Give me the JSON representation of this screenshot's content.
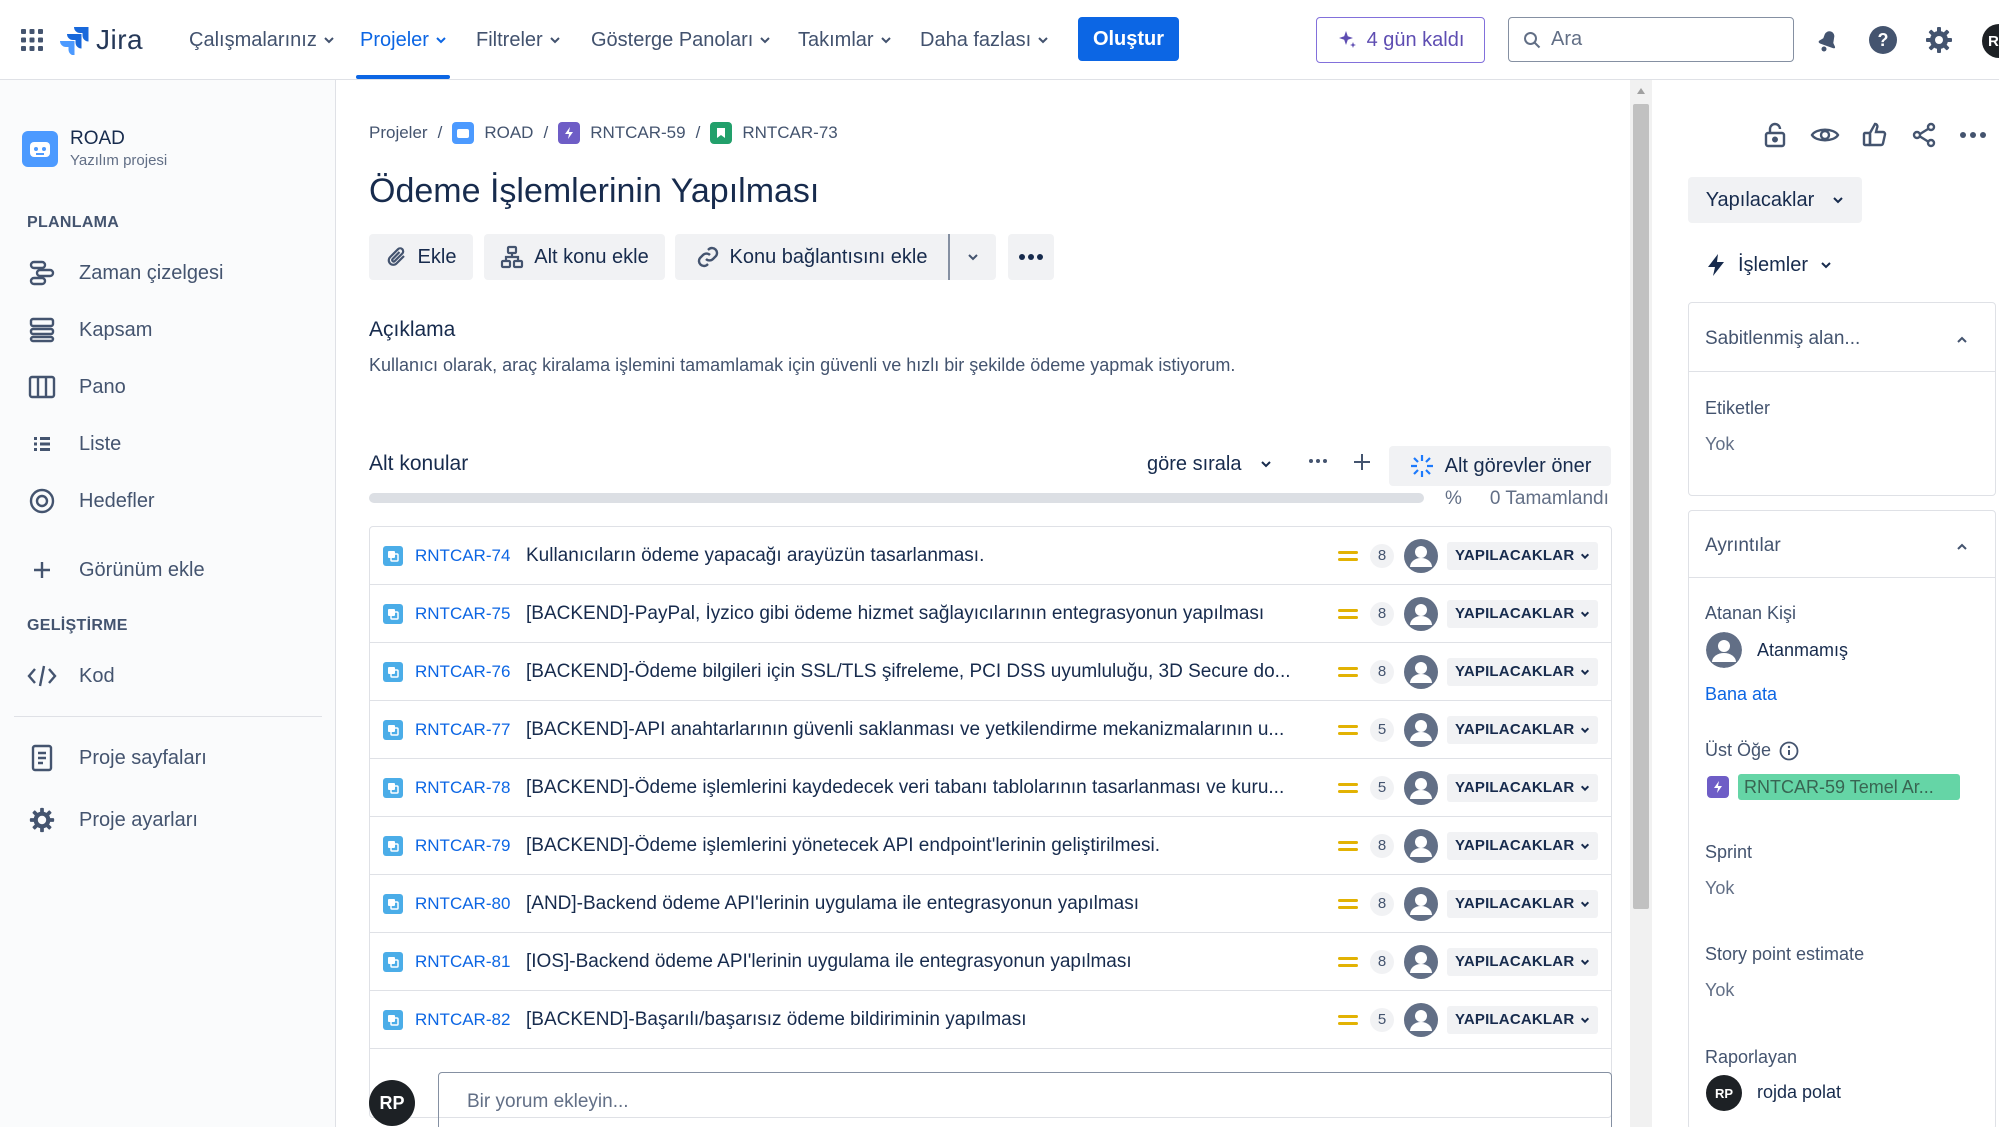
{
  "colors": {
    "brand": "#0c66e4",
    "status_done": "#22a06b",
    "prio_medium": "#e2b203",
    "subtask": "#4bade8",
    "epic": "#6e5dc6",
    "story": "#22a06b",
    "trial": "#5e4db2"
  },
  "topnav": {
    "logo": "Jira",
    "items": [
      "Çalışmalarınız",
      "Projeler",
      "Filtreler",
      "Gösterge Panoları",
      "Takımlar",
      "Daha fazlası"
    ],
    "active_item": "Projeler",
    "create_label": "Oluştur",
    "trial_label": "4 gün kaldı",
    "search_placeholder": "Ara",
    "avatar_initial": "R"
  },
  "sidebar": {
    "project_name": "ROAD",
    "project_type": "Yazılım projesi",
    "planning_header": "PLANLAMA",
    "planning_items": [
      {
        "label": "Zaman çizelgesi",
        "icon": "timeline-icon"
      },
      {
        "label": "Kapsam",
        "icon": "backlog-icon"
      },
      {
        "label": "Pano",
        "icon": "board-icon"
      },
      {
        "label": "Liste",
        "icon": "list-icon"
      },
      {
        "label": "Hedefler",
        "icon": "goals-icon"
      }
    ],
    "add_view": "Görünüm ekle",
    "dev_header": "GELİŞTİRME",
    "code": "Kod",
    "pages": "Proje sayfaları",
    "settings": "Proje ayarları"
  },
  "breadcrumb": {
    "root": "Projeler",
    "project": "ROAD",
    "epic": "RNTCAR-59",
    "issue": "RNTCAR-73"
  },
  "issue": {
    "title": "Ödeme İşlemlerinin Yapılması",
    "toolbar": {
      "attach": "Ekle",
      "add_child": "Alt konu ekle",
      "add_link": "Konu bağlantısını ekle"
    },
    "description_label": "Açıklama",
    "description": "Kullanıcı olarak, araç kiralama işlemini tamamlamak için güvenli ve hızlı bir şekilde ödeme yapmak istiyorum.",
    "subtasks_label": "Alt konular",
    "sort_label": "göre sırala",
    "suggest_label": "Alt görevler öner",
    "progress_percent_sign": "%",
    "progress_done": "0 Tamamlandı",
    "progress_fraction": 0,
    "subtasks": [
      {
        "key": "RNTCAR-74",
        "summary": "Kullanıcıların ödeme yapacağı arayüzün tasarlanması.",
        "points": "8",
        "status": "YAPILACAKLAR"
      },
      {
        "key": "RNTCAR-75",
        "summary": "[BACKEND]-PayPal, İyzico gibi ödeme hizmet sağlayıcılarının entegrasyonun yapılması",
        "points": "8",
        "status": "YAPILACAKLAR"
      },
      {
        "key": "RNTCAR-76",
        "summary": "[BACKEND]-Ödeme bilgileri için SSL/TLS şifreleme, PCI DSS uyumluluğu, 3D Secure do...",
        "points": "8",
        "status": "YAPILACAKLAR"
      },
      {
        "key": "RNTCAR-77",
        "summary": "[BACKEND]-API anahtarlarının güvenli saklanması ve yetkilendirme mekanizmalarının u...",
        "points": "5",
        "status": "YAPILACAKLAR"
      },
      {
        "key": "RNTCAR-78",
        "summary": "[BACKEND]-Ödeme işlemlerini kaydedecek veri tabanı tablolarının tasarlanması ve kuru...",
        "points": "5",
        "status": "YAPILACAKLAR"
      },
      {
        "key": "RNTCAR-79",
        "summary": "[BACKEND]-Ödeme işlemlerini yönetecek API endpoint'lerinin geliştirilmesi.",
        "points": "8",
        "status": "YAPILACAKLAR"
      },
      {
        "key": "RNTCAR-80",
        "summary": "[AND]-Backend ödeme API'lerinin uygulama ile entegrasyonun yapılması",
        "points": "8",
        "status": "YAPILACAKLAR"
      },
      {
        "key": "RNTCAR-81",
        "summary": "[IOS]-Backend ödeme API'lerinin uygulama ile entegrasyonun yapılması",
        "points": "8",
        "status": "YAPILACAKLAR"
      },
      {
        "key": "RNTCAR-82",
        "summary": "[BACKEND]-Başarılı/başarısız ödeme bildiriminin yapılması",
        "points": "5",
        "status": "YAPILACAKLAR"
      }
    ],
    "comment_avatar": "RP",
    "comment_placeholder": "Bir yorum ekleyin..."
  },
  "details": {
    "status": "Yapılacaklar",
    "actions": "İşlemler",
    "pinned_header": "Sabitlenmiş alan...",
    "labels_label": "Etiketler",
    "labels_value": "Yok",
    "details_header": "Ayrıntılar",
    "assignee_label": "Atanan Kişi",
    "assignee_value": "Atanmamış",
    "assign_to_me": "Bana ata",
    "parent_label": "Üst Öğe",
    "parent_value": "RNTCAR-59 Temel Ar...",
    "sprint_label": "Sprint",
    "sprint_value": "Yok",
    "sp_label": "Story point estimate",
    "sp_value": "Yok",
    "reporter_label": "Raporlayan",
    "reporter_initials": "RP",
    "reporter_name": "rojda polat"
  }
}
